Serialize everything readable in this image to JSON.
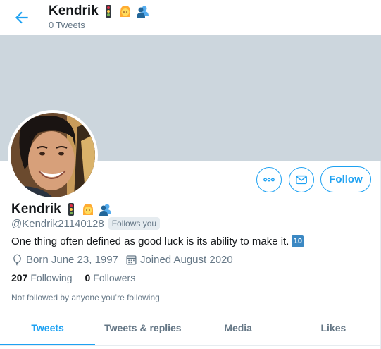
{
  "header": {
    "name": "Kendrik",
    "tweet_count": "0 Tweets"
  },
  "profile": {
    "name": "Kendrik",
    "emoji": [
      "traffic-light",
      "woman-blond",
      "busts-in-silhouette"
    ],
    "handle": "@Kendrik21140128",
    "follows_you": "Follows you",
    "bio": "One thing often defined as good luck is its ability to make it.",
    "bio_keycap": "10",
    "born": "Born June 23, 1997",
    "joined": "Joined August 2020",
    "following_count": "207",
    "following_label": "Following",
    "followers_count": "0",
    "followers_label": "Followers",
    "not_followed": "Not followed by anyone you’re following"
  },
  "actions": {
    "follow_label": "Follow"
  },
  "tabs": [
    {
      "label": "Tweets",
      "active": true
    },
    {
      "label": "Tweets & replies",
      "active": false
    },
    {
      "label": "Media",
      "active": false
    },
    {
      "label": "Likes",
      "active": false
    }
  ],
  "colors": {
    "accent": "#1da1f2",
    "banner": "#ccd6dd",
    "muted": "#657786"
  }
}
